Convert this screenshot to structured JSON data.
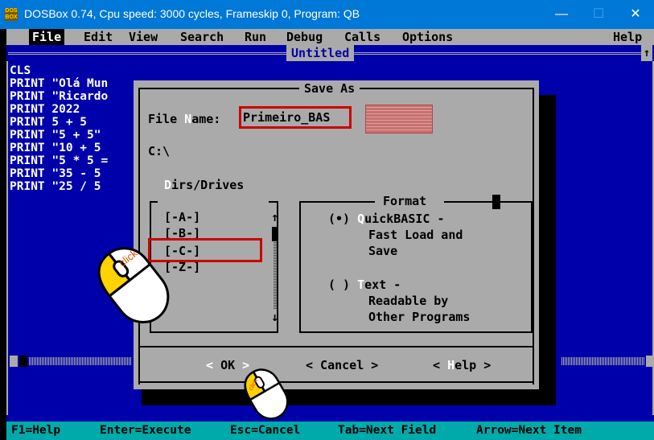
{
  "window": {
    "title": "DOSBox 0.74, Cpu speed:    3000 cycles, Frameskip  0, Program:      QB",
    "icon_label": "DOS BOX",
    "minimize": "—",
    "maximize": "☐",
    "close": "✕"
  },
  "menu": {
    "items": [
      "File",
      "Edit",
      "View",
      "Search",
      "Run",
      "Debug",
      "Calls",
      "Options"
    ],
    "help": "Help"
  },
  "editor": {
    "document_title": "Untitled",
    "scroll_arrow": "↑",
    "lines": [
      "CLS",
      "PRINT \"Olá Mun",
      "PRINT \"Ricardo",
      "PRINT 2022",
      "PRINT 5 + 5",
      "PRINT \"5 + 5\"",
      "PRINT \"10 + 5",
      "PRINT \"5 * 5 =",
      "PRINT \"35 - 5",
      "PRINT \"25 / 5"
    ]
  },
  "dialog": {
    "title": "Save As",
    "file_name_label_pre": "File ",
    "file_name_label_hot": "N",
    "file_name_label_post": "ame:",
    "file_name_value": "Primeiro_BAS",
    "current_path": "C:\\",
    "dirs_label_hot": "D",
    "dirs_label_post": "irs/Drives",
    "drives": [
      "[-A-]",
      "[-B-]",
      "[-C-]",
      "[-Z-]"
    ],
    "scroll_up": "↑",
    "scroll_down": "↓",
    "format_title": "Format",
    "format_options": [
      {
        "marker": "(•)",
        "hot": "Q",
        "line1": "uickBASIC -",
        "line2": "Fast Load and",
        "line3": "Save"
      },
      {
        "marker": "( )",
        "hot": "T",
        "line1": "ext -",
        "line2": "Readable by",
        "line3": "Other Programs"
      }
    ],
    "ok_left": "<",
    "ok_label": "OK",
    "ok_right": ">",
    "cancel_label": "< Cancel >",
    "help_left": "< ",
    "help_hot": "H",
    "help_post": "elp >"
  },
  "annotations": {
    "click_label": "click"
  },
  "status_bar": {
    "f1": "F1=Help",
    "enter": "Enter=Execute",
    "esc": "Esc=Cancel",
    "tab": "Tab=Next Field",
    "arrow": "Arrow=Next Item"
  },
  "colors": {
    "dos_blue": "#0000aa",
    "dos_gray": "#aaaaaa",
    "status_cyan": "#00aaaa",
    "titlebar_blue": "#0078d7",
    "highlight_red": "#cc0000"
  }
}
